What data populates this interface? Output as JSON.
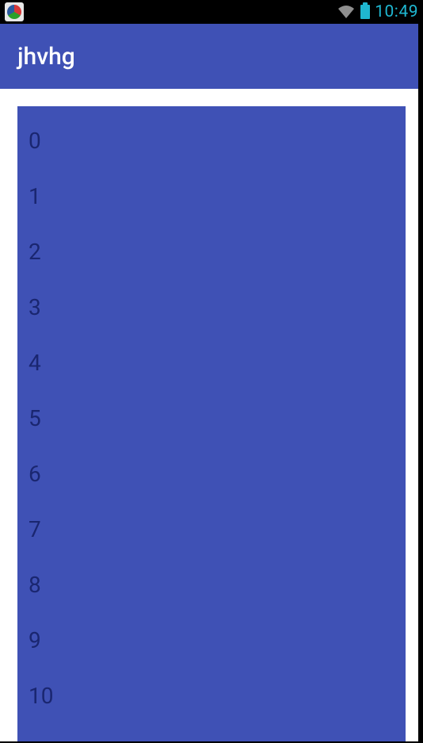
{
  "statusbar": {
    "clock": "10:49"
  },
  "appbar": {
    "title": "jhvhg"
  },
  "list": {
    "items": [
      "0",
      "1",
      "2",
      "3",
      "4",
      "5",
      "6",
      "7",
      "8",
      "9",
      "10"
    ]
  }
}
